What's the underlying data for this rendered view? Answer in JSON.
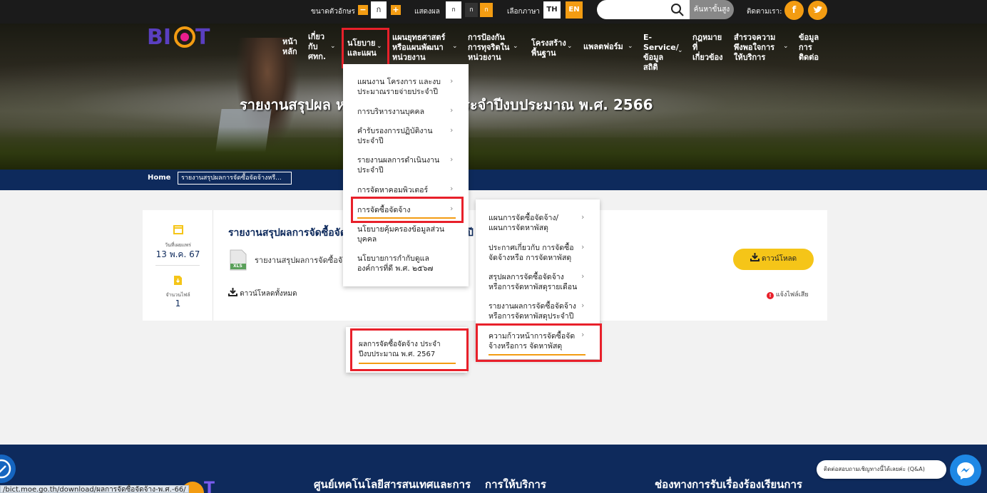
{
  "topbar": {
    "font_size_label": "ขนาดตัวอักษร",
    "font_minus": "−",
    "font_normal": "ก",
    "font_plus": "+",
    "display_label": "แสดงผล",
    "display_options": [
      "ก",
      "ก",
      "ก"
    ],
    "language_label": "เลือกภาษา",
    "lang_th": "TH",
    "lang_en": "EN",
    "search_placeholder": "",
    "advanced_search": "ค้นหาขั้นสูง",
    "follow_label": "ติดตามเรา:",
    "social": [
      "f",
      "t"
    ]
  },
  "nav": {
    "items": [
      {
        "label": "หน้า\nหลัก"
      },
      {
        "label": "เกี่ยว\nกับ\nศทก."
      },
      {
        "label": "นโยบาย\nและแผน"
      },
      {
        "label": "แผนยุทธศาสตร์\nหรือแผนพัฒนา\nหน่วยงาน"
      },
      {
        "label": "การป้องกัน\nการทุจริตใน\nหน่วยงาน"
      },
      {
        "label": "โครงสร้าง\nพื้นฐาน"
      },
      {
        "label": "แพลตฟอร์ม"
      },
      {
        "label": "E-\nService/\nข้อมูล\nสถิติ"
      },
      {
        "label": "กฎหมาย\nที่\nเกี่ยวข้อง"
      },
      {
        "label": "สำรวจความ\nพึงพอใจการ\nให้บริการ"
      },
      {
        "label": "ข้อมูล\nการ\nติดต่อ"
      }
    ]
  },
  "hero": {
    "title": "รายงานสรุปผล                                  หรือการจัดหาพัสดุ ประจำปีงบประมาณ พ.ศ. 2566"
  },
  "breadcrumb": {
    "home": "Home",
    "current": "รายงานสรุปผลการจัดซื้อจัดจ้างหรื..."
  },
  "card": {
    "date_label": "วันที่เผยแพร่",
    "date_value": "13 พ.ค. 67",
    "files_label": "จำนวนไฟล์",
    "files_value": "1",
    "title": "รายงานสรุปผลการจัดซื้อจัด",
    "title_tail": "ปี",
    "file_name": "รายงานสรุปผลการจัดซื้อจั",
    "download": "ดาวน์โหลด",
    "download_all": "ดาวน์โหลดทั้งหมด",
    "report_broken": "แจ้งไฟล์เสีย",
    "file_type": "XLS"
  },
  "menu1": {
    "items": [
      {
        "label": "แผนงาน โครงการ และงบ\nประมาณรายจ่ายประจำปี",
        "arrow": true
      },
      {
        "label": "การบริหารงานบุคคล",
        "arrow": true
      },
      {
        "label": "คำรับรองการปฏิบัติงาน\nประจำปี",
        "arrow": true
      },
      {
        "label": "รายงานผลการดำเนินงาน\nประจำปี",
        "arrow": true
      },
      {
        "label": "การจัดหาคอมพิวเตอร์",
        "arrow": true
      },
      {
        "label": "การจัดซื้อจัดจ้าง",
        "arrow": true
      },
      {
        "label": "นโยบายคุ้มครองข้อมูลส่วน\nบุคคล",
        "arrow": false
      },
      {
        "label": "นโยบายการกำกับดูแล\nองค์การที่ดี พ.ศ. ๒๕๖๗",
        "arrow": false
      }
    ]
  },
  "menu2": {
    "items": [
      {
        "label": "แผนการจัดซื้อจัดจ้าง/\nแผนการจัดหาพัสดุ",
        "arrow": true
      },
      {
        "label": "ประกาศเกี่ยวกับ การจัดซื้อ\nจัดจ้างหรือ การจัดหาพัสดุ",
        "arrow": true
      },
      {
        "label": "สรุปผลการจัดซื้อจัดจ้าง\nหรือการจัดหาพัสดุรายเดือน",
        "arrow": true
      },
      {
        "label": "รายงานผลการจัดซื้อจัดจ้าง\nหรือการจัดหาพัสดุประจำปี",
        "arrow": true
      },
      {
        "label": "ความก้าวหน้าการจัดซื้อจัด\nจ้างหรือการ จัดหาพัสดุ",
        "arrow": true
      }
    ]
  },
  "menu3": {
    "items": [
      {
        "label": "ผลการจัดซื้อจัดจ้าง ประจำ\nปีงบประมาณ พ.ศ. 2567"
      }
    ]
  },
  "footer": {
    "col1": "ศูนย์เทคโนโลยีสารสนเทศและการ",
    "col2": "การให้บริการ",
    "col3": "ช่องทางการรับเรื่องร้องเรียนการ",
    "chat_bubble": "ติดต่อสอบถามเชิญทางนี้ได้เลยค่ะ (Q&A)",
    "status_url": "/bict.moe.go.th/download/ผลการจัดซื้อจัดจ้าง-พ.ศ.-66/"
  },
  "colors": {
    "accent": "#f39c12",
    "navy": "#0e2a5c",
    "highlight": "#e8202a",
    "button_yellow": "#f5c518"
  }
}
